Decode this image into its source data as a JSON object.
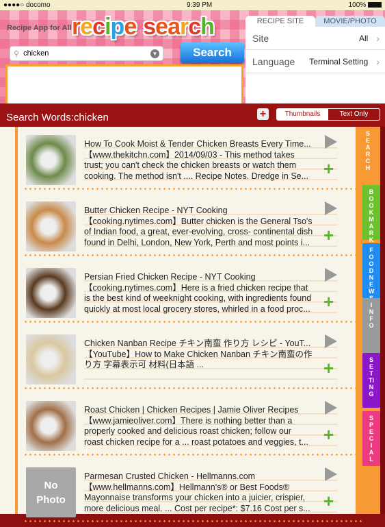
{
  "status_bar": {
    "carrier": "●●●●○ docomo",
    "wifi_icon": "wifi-icon",
    "time": "9:39 PM",
    "battery": "100%"
  },
  "header": {
    "tagline": "Recipe App for All",
    "logo": "recipe search",
    "logo_colors": [
      "#e8541a",
      "#f2a81c",
      "#e23a2a",
      "#54b52c",
      "#2aa0de",
      "#e8541a",
      "#f2a81c",
      "#e23a2a",
      "#e8541a"
    ],
    "search": {
      "value": "chicken",
      "icon": "search-icon",
      "button": "Search"
    },
    "panel": {
      "tabs": [
        "RECIPE SITE",
        "MOVIE/PHOTO"
      ],
      "active_tab": "RECIPE SITE",
      "rows": [
        {
          "label": "Site",
          "value": "All"
        },
        {
          "label": "Language",
          "value": "Terminal Setting"
        }
      ]
    }
  },
  "results_bar": {
    "title": "Search Words:chicken",
    "view_modes": [
      "Thumbnails",
      "Text Only"
    ],
    "selected_view": "Thumbnails"
  },
  "results": [
    {
      "title": "How To Cook Moist & Tender Chicken Breasts Every Time...",
      "lines": [
        "【www.thekitchn.com】2014/09/03 - This method takes",
        "trust; you can't check the chicken breasts or watch them",
        "cooking. The method isn't .... Recipe Notes. Dredge in Se..."
      ],
      "thumb": "#6e8a4a"
    },
    {
      "title": "Butter Chicken Recipe - NYT Cooking",
      "lines": [
        "【cooking.nytimes.com】Butter chicken is the General Tso's",
        "of Indian food, a great, ever-evolving, cross- continental dish",
        "found in Delhi, London, New York, Perth and most points i..."
      ],
      "thumb": "#c98a4a"
    },
    {
      "title": "Persian Fried Chicken Recipe - NYT Cooking",
      "lines": [
        "【cooking.nytimes.com】Here is a fried chicken recipe that",
        "is the best kind of weeknight cooking, with ingredients found",
        "quickly at most local grocery stores, whirled in a food proc..."
      ],
      "thumb": "#5a3a20"
    },
    {
      "title": "Chicken Nanban Recipe チキン南蛮 作り方 レシピ - YouT...",
      "lines": [
        "【YouTube】How to Make Chicken Nanban チキン南蛮の作",
        "り方 字幕表示可 材料(日本語 ..."
      ],
      "thumb": "#d9c7a0"
    },
    {
      "title": "Roast Chicken | Chicken Recipes | Jamie Oliver Recipes",
      "lines": [
        "【www.jamieoliver.com】There is nothing better than a",
        "properly cooked and delicious roast chicken; follow our",
        "roast chicken recipe for a ... roast potatoes and veggies, t..."
      ],
      "thumb": "#a0704a"
    },
    {
      "title": "Parmesan Crusted Chicken - Hellmanns.com",
      "lines": [
        "【www.hellmanns.com】Hellmann's® or Best Foods®",
        "Mayonnaise transforms your chicken into a juicier, crispier,",
        "more delicious meal. ... Cost per recipe*: $7.16 Cost per s..."
      ],
      "thumb_text": [
        "No",
        "Photo"
      ]
    }
  ],
  "side_tabs": [
    {
      "label": "SEARCH",
      "color": "#f79a34"
    },
    {
      "label": "BOOKMARK",
      "color": "#6cc22c"
    },
    {
      "label": "FOODNEWS",
      "color": "#1e8cf0"
    },
    {
      "label": "INFO",
      "color": "#9a9a9a"
    },
    {
      "label": "SETTING",
      "color": "#8a18c8"
    },
    {
      "label": "SPECIAL",
      "color": "#ee3a80"
    }
  ]
}
